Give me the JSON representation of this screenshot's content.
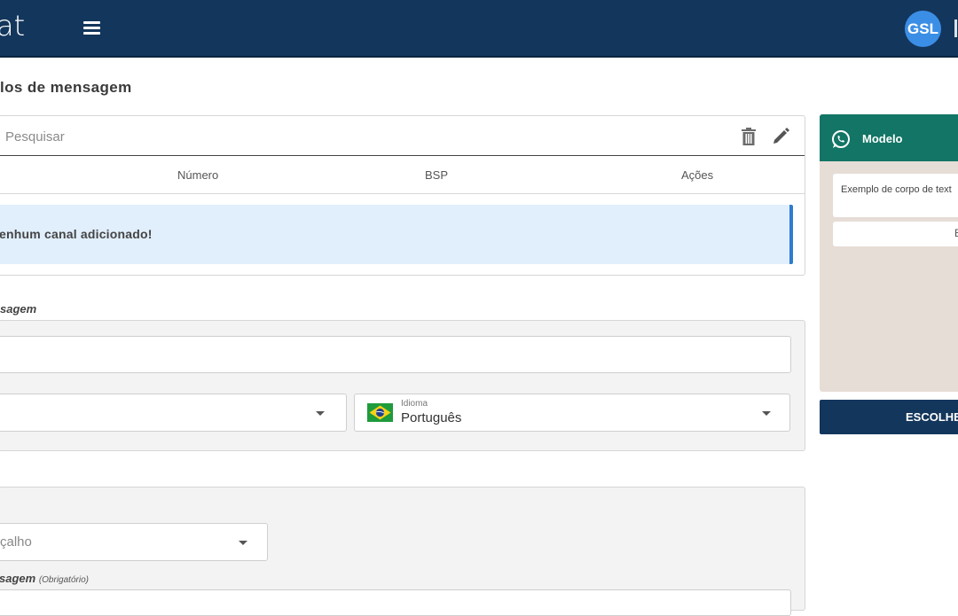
{
  "header": {
    "brand": "at",
    "menu_icon": "hamburger-menu-icon",
    "avatar_initials": "GSL",
    "colors": {
      "bar": "#13365c",
      "avatar": "#3b8ee5"
    }
  },
  "page": {
    "title": "los de mensagem"
  },
  "channels": {
    "search_placeholder": "Pesquisar",
    "columns": [
      "Número",
      "BSP",
      "Ações"
    ],
    "empty_message": "enhum canal adicionado!",
    "alert_color": "#e1effd"
  },
  "message_section": {
    "label": "sagem",
    "language": {
      "label": "Idioma",
      "value": "Português",
      "flag": "brazil-flag-icon"
    }
  },
  "content_section": {
    "header_select_value": "çalho",
    "body_label": "sagem",
    "body_required": "(Obrigatório)"
  },
  "preview": {
    "title": "Modelo",
    "body_text": "Exemplo de corpo de text",
    "button_text": "E",
    "header_color": "#137565",
    "icon": "whatsapp-icon"
  },
  "choose_button": {
    "label": "ESCOLHE"
  }
}
